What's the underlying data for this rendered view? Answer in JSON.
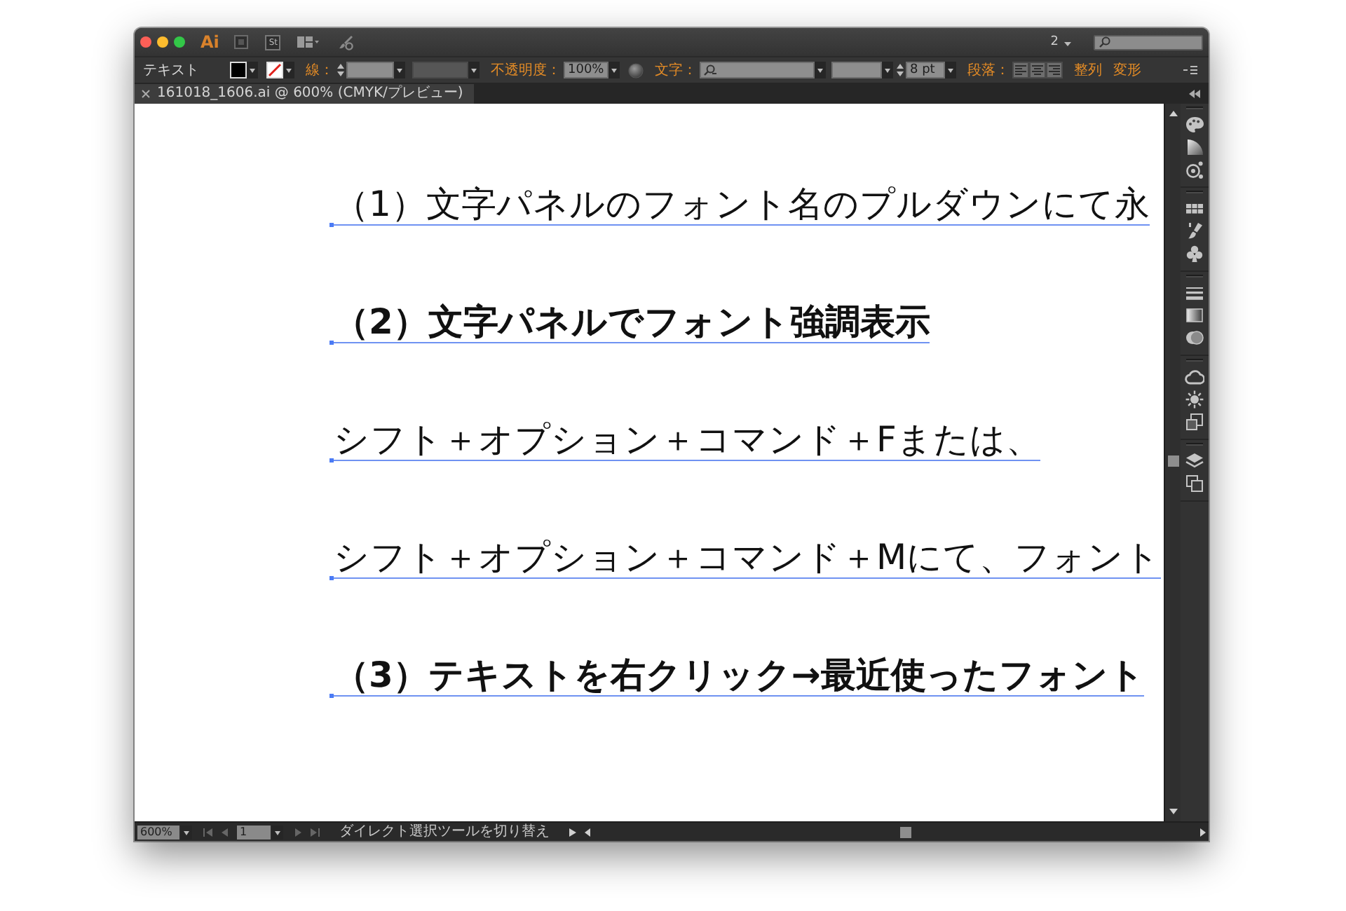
{
  "title_bar": {
    "app_logo": "Ai",
    "shortcut_button": "St",
    "workspace_menu": "2"
  },
  "control_bar": {
    "selection_type": "テキスト",
    "stroke_label": "線：",
    "opacity_label": "不透明度：",
    "opacity_value": "100%",
    "character_label": "文字：",
    "font_size": "8 pt",
    "paragraph_label": "段落：",
    "links": [
      "整列",
      "変形"
    ]
  },
  "document_tabs": [
    {
      "title": "161018_1606.ai @ 600% (CMYK/プレビュー)",
      "selected": true
    }
  ],
  "canvas": {
    "text_lines": [
      {
        "text": "（1）文字パネルのフォント名のプルダウンにて永",
        "kind": "plain",
        "selected": true
      },
      {
        "text": "（2）文字パネルでフォント強調表示",
        "kind": "emphasized",
        "selected": true
      },
      {
        "text": "シフト＋オプション＋コマンド＋Fまたは、",
        "kind": "plain",
        "selected": true
      },
      {
        "text": "シフト＋オプション＋コマンド＋Mにて、フォント",
        "kind": "plain",
        "selected": true
      },
      {
        "text": "（3）テキストを右クリック→最近使ったフォント",
        "kind": "emphasized",
        "selected": true
      }
    ]
  },
  "status_bar": {
    "zoom": "600%",
    "artboard": "1",
    "status_text": "ダイレクト選択ツールを切り替え"
  }
}
